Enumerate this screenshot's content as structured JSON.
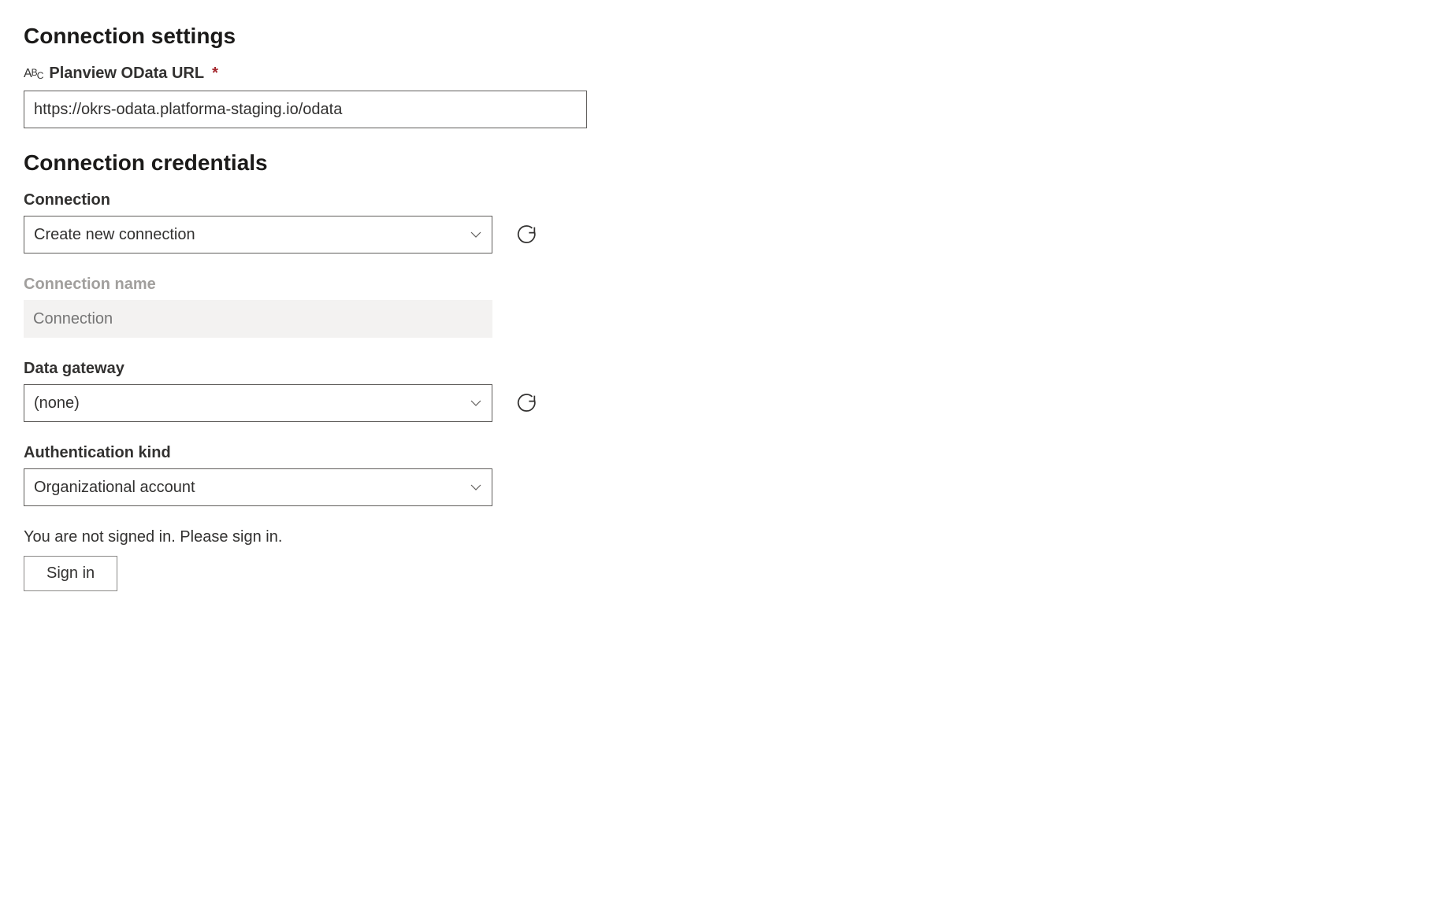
{
  "settings": {
    "heading": "Connection settings",
    "url_label": "Planview OData URL",
    "url_value": "https://okrs-odata.platforma-staging.io/odata"
  },
  "credentials": {
    "heading": "Connection credentials",
    "connection_label": "Connection",
    "connection_value": "Create new connection",
    "connection_name_label": "Connection name",
    "connection_name_placeholder": "Connection",
    "data_gateway_label": "Data gateway",
    "data_gateway_value": "(none)",
    "auth_kind_label": "Authentication kind",
    "auth_kind_value": "Organizational account",
    "signin_status": "You are not signed in. Please sign in.",
    "signin_button_label": "Sign in"
  }
}
